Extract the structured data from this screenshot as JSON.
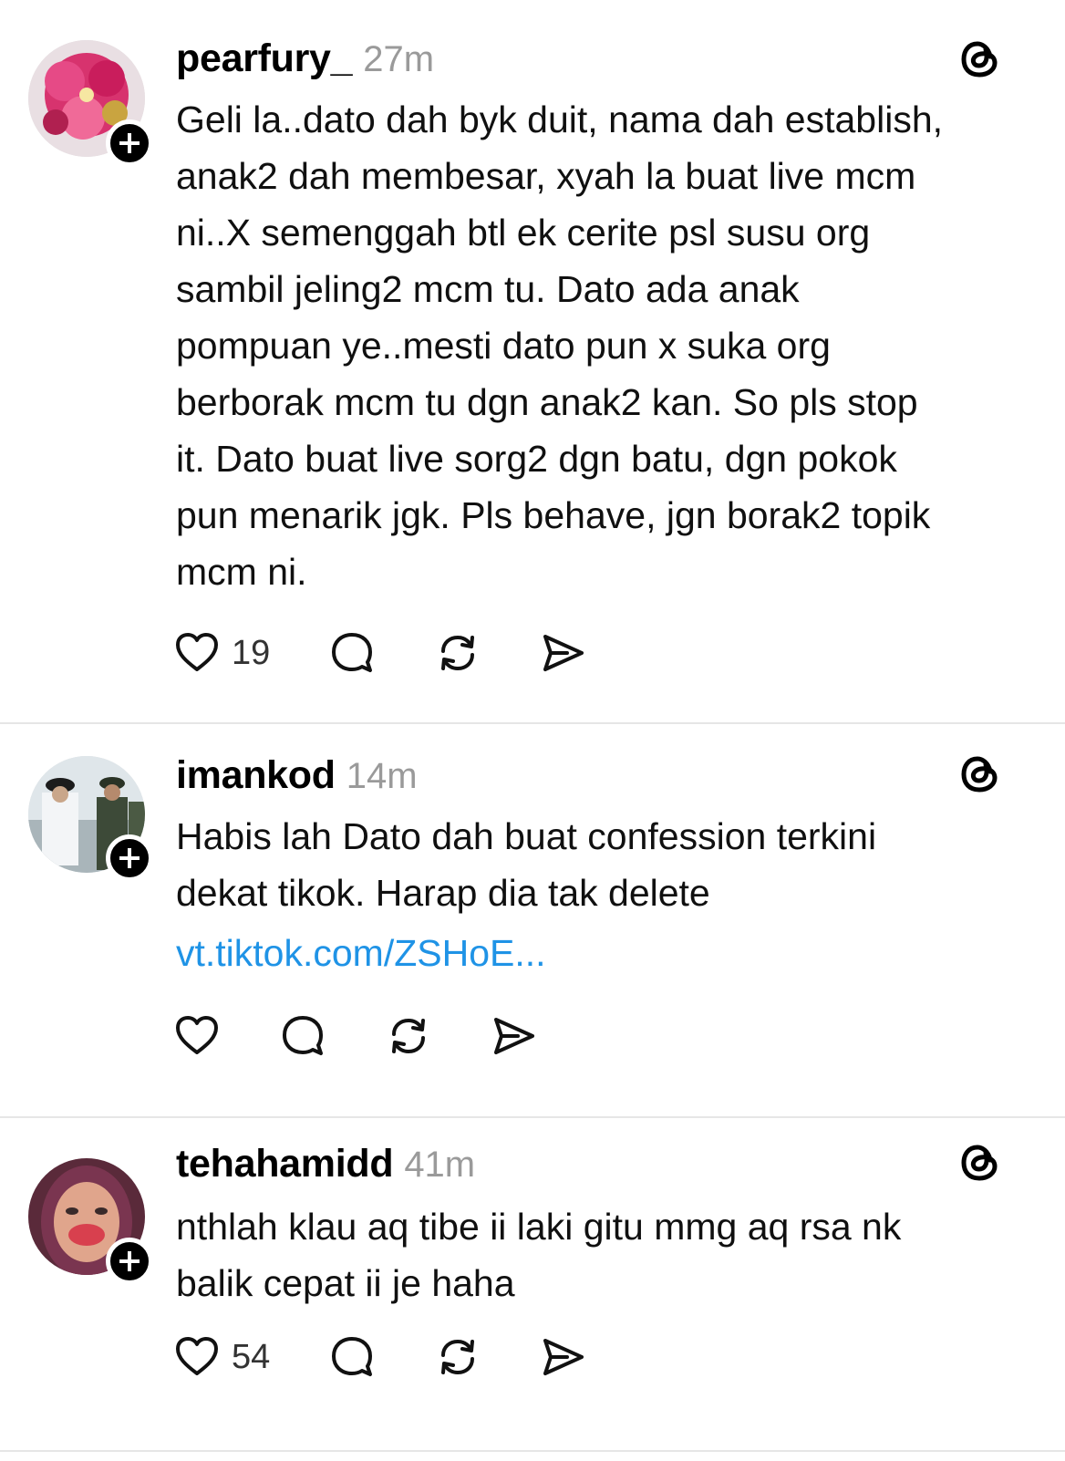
{
  "posts": [
    {
      "username": "pearfury_",
      "time": "27m",
      "text": "Geli la..dato dah byk duit, nama dah establish,\nanak2 dah membesar, xyah la buat live mcm\nni..X semenggah btl ek cerite psl susu org\nsambil jeling2 mcm tu. Dato ada anak\npompuan ye..mesti dato pun x suka org\nberborak mcm tu dgn anak2 kan. So pls stop\nit. Dato buat live sorg2 dgn batu, dgn pokok\npun menarik jgk. Pls behave, jgn borak2 topik\nmcm ni.",
      "likes": "19"
    },
    {
      "username": "imankod",
      "time": "14m",
      "text": "Habis lah Dato dah buat confession terkini\ndekat tikok. Harap dia tak delete",
      "link": "vt.tiktok.com/ZSHoE...",
      "likes": ""
    },
    {
      "username": "tehahamidd",
      "time": "41m",
      "text": "nthlah klau aq tibe ii laki gitu mmg aq rsa nk\nbalik cepat ii je haha",
      "likes": "54"
    }
  ],
  "icons": {
    "follow": "plus-icon",
    "brand": "threads-logo-icon",
    "like": "heart-icon",
    "reply": "comment-bubble-icon",
    "repost": "repost-icon",
    "share": "share-send-icon"
  },
  "colors": {
    "link": "#1f93e6",
    "timestamp": "#9a9a9a",
    "divider": "#e6e6e6"
  }
}
